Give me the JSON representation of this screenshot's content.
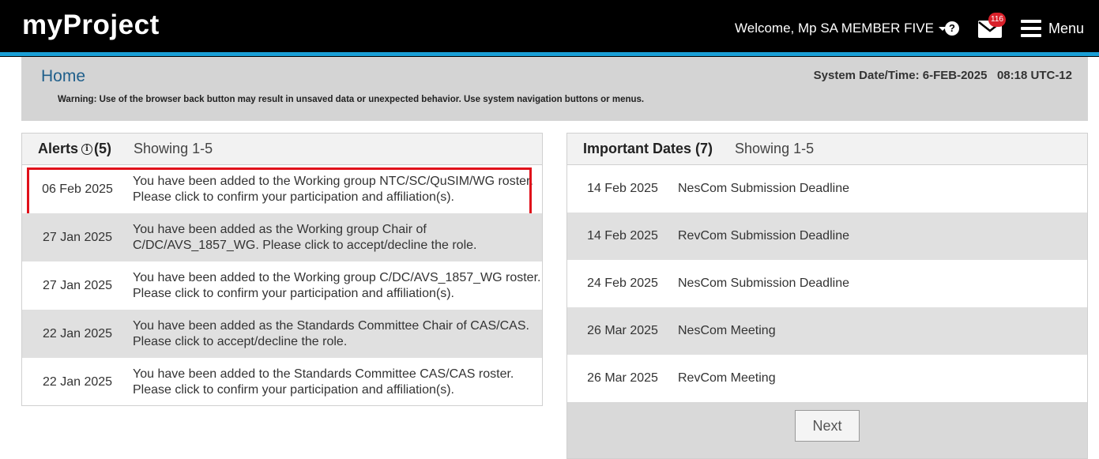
{
  "header": {
    "brand": "myProject",
    "welcome": "Welcome, Mp SA MEMBER FIVE",
    "help_symbol": "?",
    "mail_badge": "116",
    "menu_label": "Menu",
    "accent_color": "#1a9fd6",
    "badge_color": "#d9202a"
  },
  "banner": {
    "home_link": "Home",
    "system_datetime": "System Date/Time: 6-FEB-2025   08:18 UTC-12",
    "warning": "Warning: Use of the browser back button may result in unsaved data or unexpected behavior. Use system navigation buttons or menus."
  },
  "alerts": {
    "title": "Alerts",
    "info_symbol": "i",
    "count": "(5)",
    "showing": "Showing 1-5",
    "highlight_color": "#e0101a",
    "items": [
      {
        "date": "06 Feb 2025",
        "text": "You have been added to the Working group NTC/SC/QuSIM/WG roster. Please click to confirm your participation and affiliation(s)."
      },
      {
        "date": "27 Jan 2025",
        "text": "You have been added as the Working group Chair of C/DC/AVS_1857_WG. Please click to accept/decline the role."
      },
      {
        "date": "27 Jan 2025",
        "text": "You have been added to the Working group C/DC/AVS_1857_WG roster. Please click to confirm your participation and affiliation(s)."
      },
      {
        "date": "22 Jan 2025",
        "text": "You have been added as the Standards Committee Chair of CAS/CAS. Please click to accept/decline the role."
      },
      {
        "date": "22 Jan 2025",
        "text": "You have been added to the Standards Committee CAS/CAS roster. Please click to confirm your participation and affiliation(s)."
      }
    ]
  },
  "important_dates": {
    "title": "Important Dates (7)",
    "showing": "Showing 1-5",
    "items": [
      {
        "date": "14 Feb 2025",
        "event": "NesCom Submission Deadline"
      },
      {
        "date": "14 Feb 2025",
        "event": "RevCom Submission Deadline"
      },
      {
        "date": "24 Feb 2025",
        "event": "NesCom Submission Deadline"
      },
      {
        "date": "26 Mar 2025",
        "event": "NesCom Meeting"
      },
      {
        "date": "26 Mar 2025",
        "event": "RevCom Meeting"
      }
    ],
    "next_label": "Next"
  }
}
